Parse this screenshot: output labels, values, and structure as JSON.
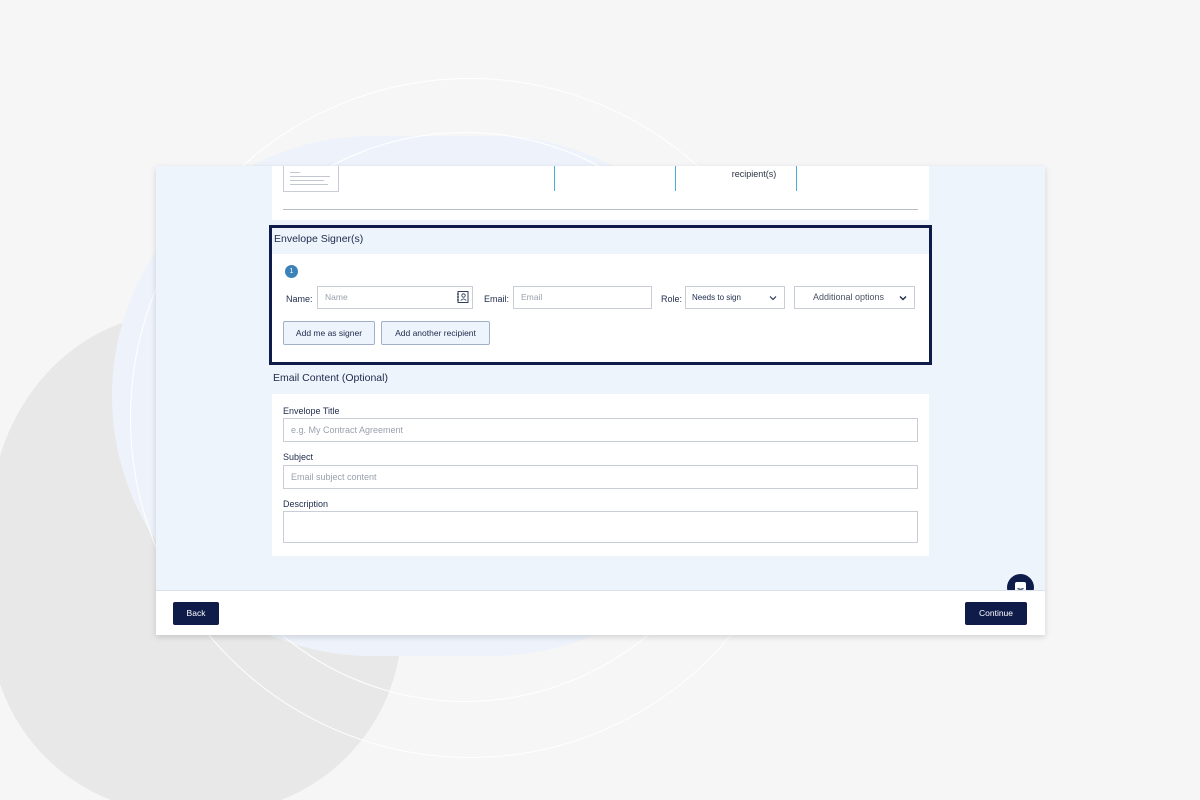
{
  "top_card": {
    "recipients_text": "recipient(s)"
  },
  "signers": {
    "section_title": "Envelope Signer(s)",
    "step_number": "1",
    "name_label": "Name:",
    "name_placeholder": "Name",
    "email_label": "Email:",
    "email_placeholder": "Email",
    "role_label": "Role:",
    "role_value": "Needs to sign",
    "additional_options_label": "Additional options",
    "add_me_button": "Add me as signer",
    "add_another_button": "Add another recipient"
  },
  "email_content": {
    "section_title": "Email Content (Optional)",
    "envelope_title_label": "Envelope Title",
    "envelope_title_placeholder": "e.g. My Contract Agreement",
    "subject_label": "Subject",
    "subject_placeholder": "Email subject content",
    "description_label": "Description",
    "description_value": ""
  },
  "footer": {
    "back_button": "Back",
    "continue_button": "Continue"
  },
  "icons": {
    "contact": "contact-book-icon",
    "chevron": "chevron-down-icon",
    "chat": "chat-icon"
  },
  "colors": {
    "primary_dark": "#0f1c4a",
    "accent_blue": "#3b82b8",
    "panel_bg": "#eef4fc"
  }
}
